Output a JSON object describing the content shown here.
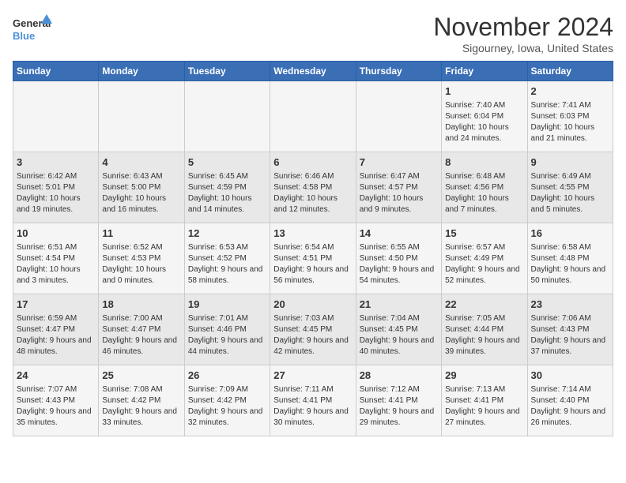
{
  "logo": {
    "line1": "General",
    "line2": "Blue"
  },
  "title": "November 2024",
  "subtitle": "Sigourney, Iowa, United States",
  "weekdays": [
    "Sunday",
    "Monday",
    "Tuesday",
    "Wednesday",
    "Thursday",
    "Friday",
    "Saturday"
  ],
  "weeks": [
    [
      {
        "day": "",
        "content": ""
      },
      {
        "day": "",
        "content": ""
      },
      {
        "day": "",
        "content": ""
      },
      {
        "day": "",
        "content": ""
      },
      {
        "day": "",
        "content": ""
      },
      {
        "day": "1",
        "content": "Sunrise: 7:40 AM\nSunset: 6:04 PM\nDaylight: 10 hours and 24 minutes."
      },
      {
        "day": "2",
        "content": "Sunrise: 7:41 AM\nSunset: 6:03 PM\nDaylight: 10 hours and 21 minutes."
      }
    ],
    [
      {
        "day": "3",
        "content": "Sunrise: 6:42 AM\nSunset: 5:01 PM\nDaylight: 10 hours and 19 minutes."
      },
      {
        "day": "4",
        "content": "Sunrise: 6:43 AM\nSunset: 5:00 PM\nDaylight: 10 hours and 16 minutes."
      },
      {
        "day": "5",
        "content": "Sunrise: 6:45 AM\nSunset: 4:59 PM\nDaylight: 10 hours and 14 minutes."
      },
      {
        "day": "6",
        "content": "Sunrise: 6:46 AM\nSunset: 4:58 PM\nDaylight: 10 hours and 12 minutes."
      },
      {
        "day": "7",
        "content": "Sunrise: 6:47 AM\nSunset: 4:57 PM\nDaylight: 10 hours and 9 minutes."
      },
      {
        "day": "8",
        "content": "Sunrise: 6:48 AM\nSunset: 4:56 PM\nDaylight: 10 hours and 7 minutes."
      },
      {
        "day": "9",
        "content": "Sunrise: 6:49 AM\nSunset: 4:55 PM\nDaylight: 10 hours and 5 minutes."
      }
    ],
    [
      {
        "day": "10",
        "content": "Sunrise: 6:51 AM\nSunset: 4:54 PM\nDaylight: 10 hours and 3 minutes."
      },
      {
        "day": "11",
        "content": "Sunrise: 6:52 AM\nSunset: 4:53 PM\nDaylight: 10 hours and 0 minutes."
      },
      {
        "day": "12",
        "content": "Sunrise: 6:53 AM\nSunset: 4:52 PM\nDaylight: 9 hours and 58 minutes."
      },
      {
        "day": "13",
        "content": "Sunrise: 6:54 AM\nSunset: 4:51 PM\nDaylight: 9 hours and 56 minutes."
      },
      {
        "day": "14",
        "content": "Sunrise: 6:55 AM\nSunset: 4:50 PM\nDaylight: 9 hours and 54 minutes."
      },
      {
        "day": "15",
        "content": "Sunrise: 6:57 AM\nSunset: 4:49 PM\nDaylight: 9 hours and 52 minutes."
      },
      {
        "day": "16",
        "content": "Sunrise: 6:58 AM\nSunset: 4:48 PM\nDaylight: 9 hours and 50 minutes."
      }
    ],
    [
      {
        "day": "17",
        "content": "Sunrise: 6:59 AM\nSunset: 4:47 PM\nDaylight: 9 hours and 48 minutes."
      },
      {
        "day": "18",
        "content": "Sunrise: 7:00 AM\nSunset: 4:47 PM\nDaylight: 9 hours and 46 minutes."
      },
      {
        "day": "19",
        "content": "Sunrise: 7:01 AM\nSunset: 4:46 PM\nDaylight: 9 hours and 44 minutes."
      },
      {
        "day": "20",
        "content": "Sunrise: 7:03 AM\nSunset: 4:45 PM\nDaylight: 9 hours and 42 minutes."
      },
      {
        "day": "21",
        "content": "Sunrise: 7:04 AM\nSunset: 4:45 PM\nDaylight: 9 hours and 40 minutes."
      },
      {
        "day": "22",
        "content": "Sunrise: 7:05 AM\nSunset: 4:44 PM\nDaylight: 9 hours and 39 minutes."
      },
      {
        "day": "23",
        "content": "Sunrise: 7:06 AM\nSunset: 4:43 PM\nDaylight: 9 hours and 37 minutes."
      }
    ],
    [
      {
        "day": "24",
        "content": "Sunrise: 7:07 AM\nSunset: 4:43 PM\nDaylight: 9 hours and 35 minutes."
      },
      {
        "day": "25",
        "content": "Sunrise: 7:08 AM\nSunset: 4:42 PM\nDaylight: 9 hours and 33 minutes."
      },
      {
        "day": "26",
        "content": "Sunrise: 7:09 AM\nSunset: 4:42 PM\nDaylight: 9 hours and 32 minutes."
      },
      {
        "day": "27",
        "content": "Sunrise: 7:11 AM\nSunset: 4:41 PM\nDaylight: 9 hours and 30 minutes."
      },
      {
        "day": "28",
        "content": "Sunrise: 7:12 AM\nSunset: 4:41 PM\nDaylight: 9 hours and 29 minutes."
      },
      {
        "day": "29",
        "content": "Sunrise: 7:13 AM\nSunset: 4:41 PM\nDaylight: 9 hours and 27 minutes."
      },
      {
        "day": "30",
        "content": "Sunrise: 7:14 AM\nSunset: 4:40 PM\nDaylight: 9 hours and 26 minutes."
      }
    ]
  ]
}
